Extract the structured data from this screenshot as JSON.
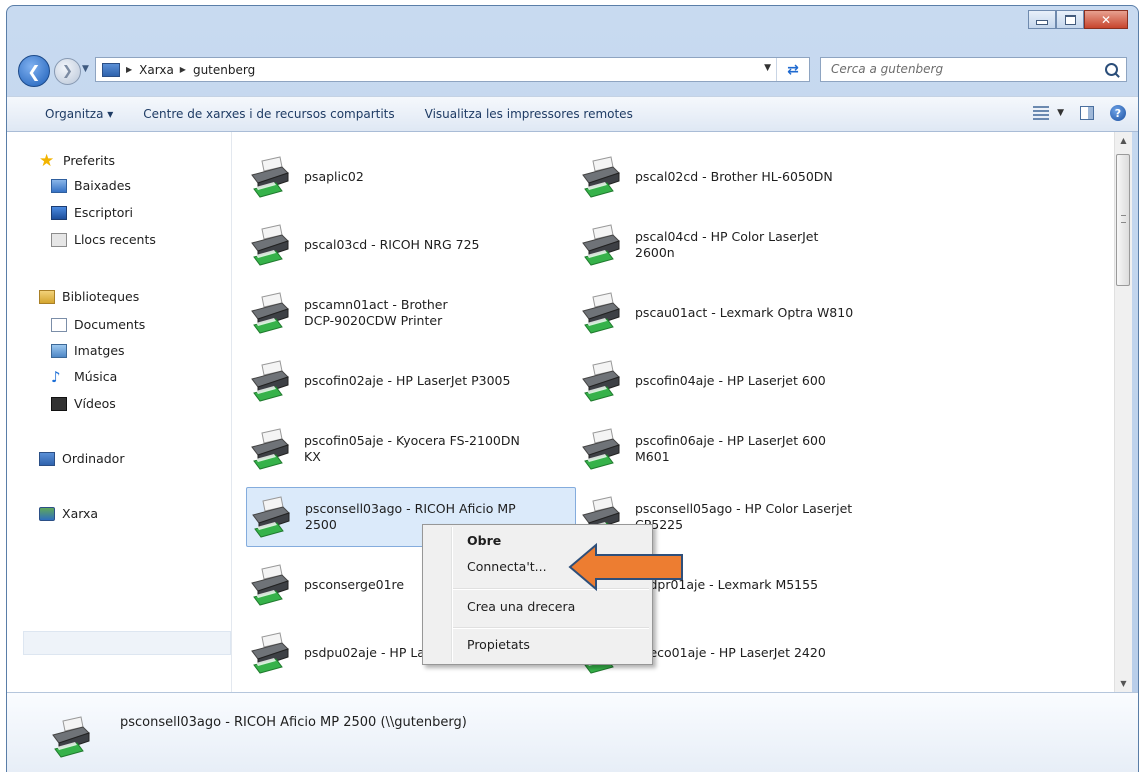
{
  "window": {
    "title_buttons": {
      "minimize": "minimize",
      "maximize": "maximize",
      "close": "✕"
    }
  },
  "navigation": {
    "back_icon": "back-arrow-icon",
    "forward_icon": "forward-arrow-icon",
    "breadcrumb": [
      "Xarxa",
      "gutenberg"
    ],
    "search_placeholder": "Cerca a gutenberg"
  },
  "toolbar": {
    "organize": "Organitza ▾",
    "network_center": "Centre de xarxes i de recursos compartits",
    "remote_printers": "Visualitza les impressores remotes"
  },
  "sidebar": {
    "favorites": "Preferits",
    "downloads": "Baixades",
    "desktop": "Escriptori",
    "recent": "Llocs recents",
    "libraries": "Biblioteques",
    "documents": "Documents",
    "images": "Imatges",
    "music": "Música",
    "videos": "Vídeos",
    "computer": "Ordinador",
    "network": "Xarxa"
  },
  "printers": [
    {
      "label": "psaplic02"
    },
    {
      "label": "pscal02cd - Brother HL-6050DN"
    },
    {
      "label": "pscal03cd - RICOH NRG 725"
    },
    {
      "label": "pscal04cd - HP Color LaserJet\n2600n"
    },
    {
      "label": "pscamn01act - Brother\nDCP-9020CDW Printer"
    },
    {
      "label": "pscau01act - Lexmark Optra W810"
    },
    {
      "label": "pscofin02aje - HP LaserJet P3005"
    },
    {
      "label": "pscofin04aje - HP Laserjet 600"
    },
    {
      "label": "pscofin05aje - Kyocera FS-2100DN\nKX"
    },
    {
      "label": "pscofin06aje - HP LaserJet 600\nM601"
    },
    {
      "label": "psconsell03ago - RICOH Aficio MP\n2500"
    },
    {
      "label": "psconsell05ago - HP Color Laserjet\nCP5225"
    },
    {
      "label": "psconserge01re"
    },
    {
      "label": "psdpr01aje - Lexmark M5155"
    },
    {
      "label": "psdpu02aje - HP LaserJet P3015"
    },
    {
      "label": "pseco01aje - HP LaserJet 2420"
    }
  ],
  "context_menu": {
    "open": "Obre",
    "connect": "Connecta't...",
    "shortcut": "Crea una drecera",
    "properties": "Propietats"
  },
  "details": {
    "text": "psconsell03ago - RICOH Aficio MP 2500 (\\\\gutenberg)"
  },
  "colors": {
    "arrow": "#ed7d31",
    "selection": "#dbeafa"
  }
}
